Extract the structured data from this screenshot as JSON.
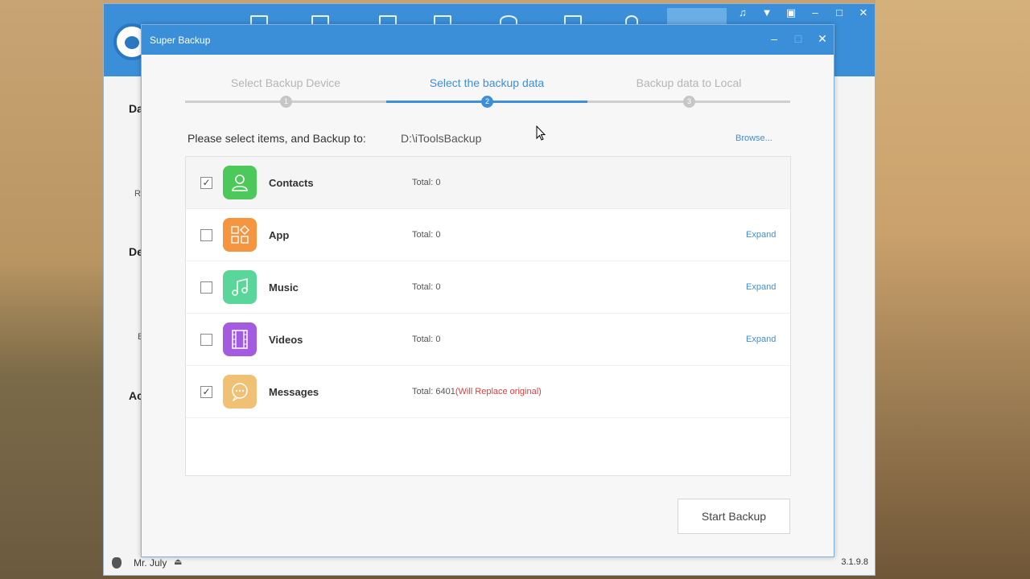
{
  "main_window": {
    "sidebar_labels": [
      "Da",
      "De",
      "Ac"
    ],
    "sidebar_small": [
      "Ri",
      "B"
    ],
    "footer": {
      "user": "Mr. July",
      "version": "3.1.9.8"
    },
    "window_controls": [
      "music-icon",
      "shirt-icon",
      "restore-icon",
      "minimize-icon",
      "maximize-icon",
      "close-icon"
    ]
  },
  "dialog": {
    "title": "Super Backup",
    "steps": [
      {
        "label": "Select Backup Device",
        "number": "1",
        "state": "done"
      },
      {
        "label": "Select the backup data",
        "number": "2",
        "state": "active"
      },
      {
        "label": "Backup data to Local",
        "number": "3",
        "state": "pending"
      }
    ],
    "destination_label": "Please select items, and Backup to:",
    "destination_path": "D:\\iToolsBackup",
    "browse_label": "Browse...",
    "items": [
      {
        "name": "Contacts",
        "total": "Total: 0",
        "warning": "",
        "checked": true,
        "expand": "",
        "color": "#4cc95a",
        "icon": "contacts-icon"
      },
      {
        "name": "App",
        "total": "Total: 0",
        "warning": "",
        "checked": false,
        "expand": "Expand",
        "color": "#f6953f",
        "icon": "app-icon"
      },
      {
        "name": "Music",
        "total": "Total: 0",
        "warning": "",
        "checked": false,
        "expand": "Expand",
        "color": "#5bd69a",
        "icon": "music-icon"
      },
      {
        "name": "Videos",
        "total": "Total: 0",
        "warning": "",
        "checked": false,
        "expand": "Expand",
        "color": "#a35ce0",
        "icon": "videos-icon"
      },
      {
        "name": "Messages",
        "total": "Total: 6401",
        "warning": "(Will Replace original)",
        "checked": true,
        "expand": "",
        "color": "#f0c174",
        "icon": "messages-icon"
      }
    ],
    "start_button": "Start Backup",
    "check_mark": "✓"
  },
  "colors": {
    "accent": "#3b8fd9",
    "warning": "#e23a3a"
  }
}
